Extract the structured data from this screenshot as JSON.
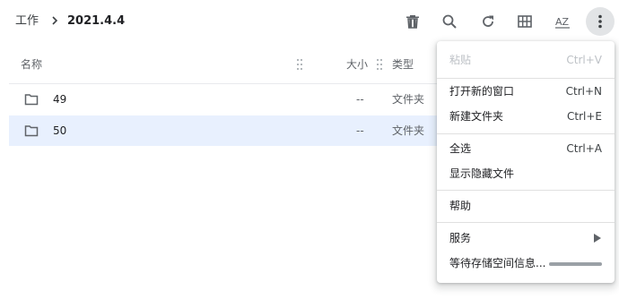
{
  "breadcrumb": {
    "root": "工作",
    "current": "2021.4.4"
  },
  "toolbar": {
    "icons": [
      "delete-icon",
      "search-icon",
      "refresh-icon",
      "grid-view-icon",
      "sort-az-icon",
      "more-vert-icon"
    ],
    "sort_glyph": "AZ"
  },
  "columns": {
    "name": "名称",
    "size": "大小",
    "type": "类型"
  },
  "rows": [
    {
      "name": "49",
      "size": "--",
      "type": "文件夹",
      "selected": false
    },
    {
      "name": "50",
      "size": "--",
      "type": "文件夹",
      "selected": true
    }
  ],
  "menu": {
    "paste": {
      "label": "粘贴",
      "shortcut": "Ctrl+V",
      "disabled": true
    },
    "new_window": {
      "label": "打开新的窗口",
      "shortcut": "Ctrl+N"
    },
    "new_folder": {
      "label": "新建文件夹",
      "shortcut": "Ctrl+E"
    },
    "select_all": {
      "label": "全选",
      "shortcut": "Ctrl+A"
    },
    "show_hidden": {
      "label": "显示隐藏文件"
    },
    "help": {
      "label": "帮助"
    },
    "services": {
      "label": "服务"
    },
    "storage": {
      "label": "等待存储空间信息..."
    }
  },
  "colors": {
    "selected_row": "#e8f0fe",
    "icon": "#5f6368",
    "active_button": "#e2e4e6"
  }
}
